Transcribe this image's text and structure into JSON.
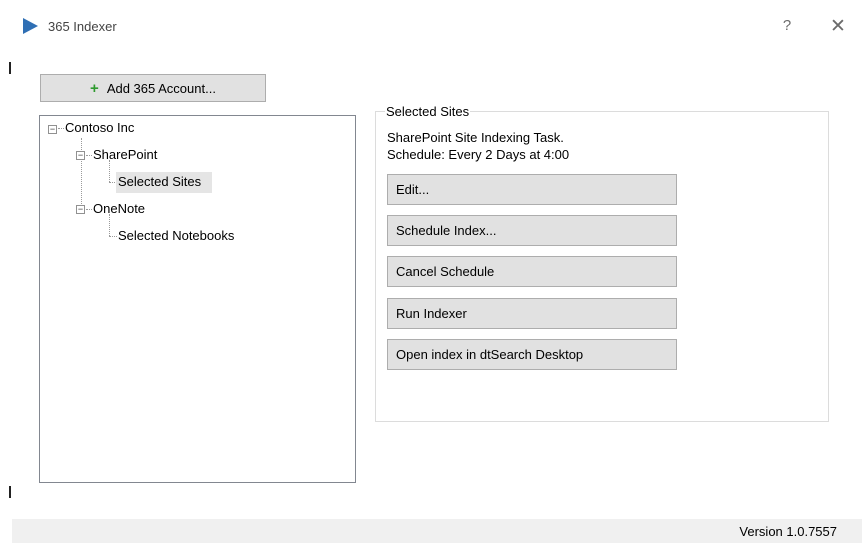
{
  "window": {
    "title": "365 Indexer",
    "help_glyph": "?",
    "close_glyph": "✕"
  },
  "toolbar": {
    "add_account_label": "Add 365 Account...",
    "add_account_icon": "+"
  },
  "tree": {
    "root": "Contoso Inc",
    "sharepoint": "SharePoint",
    "selected_sites": "Selected Sites",
    "onenote": "OneNote",
    "selected_notebooks": "Selected Notebooks",
    "expanded_glyph": "−"
  },
  "panel": {
    "group_title": "Selected Sites",
    "task_description": "SharePoint Site Indexing Task.",
    "schedule_text": "Schedule: Every 2 Days at 4:00",
    "buttons": {
      "edit": "Edit...",
      "schedule_index": "Schedule Index...",
      "cancel_schedule": "Cancel Schedule",
      "run_indexer": "Run Indexer",
      "open_index": "Open index in dtSearch Desktop"
    }
  },
  "status": {
    "version": "Version 1.0.7557"
  },
  "colors": {
    "accent": "#2f6fb4",
    "add_icon": "#2e9a2e",
    "button_face": "#e1e1e1",
    "status_bar": "#f0f0f0"
  }
}
